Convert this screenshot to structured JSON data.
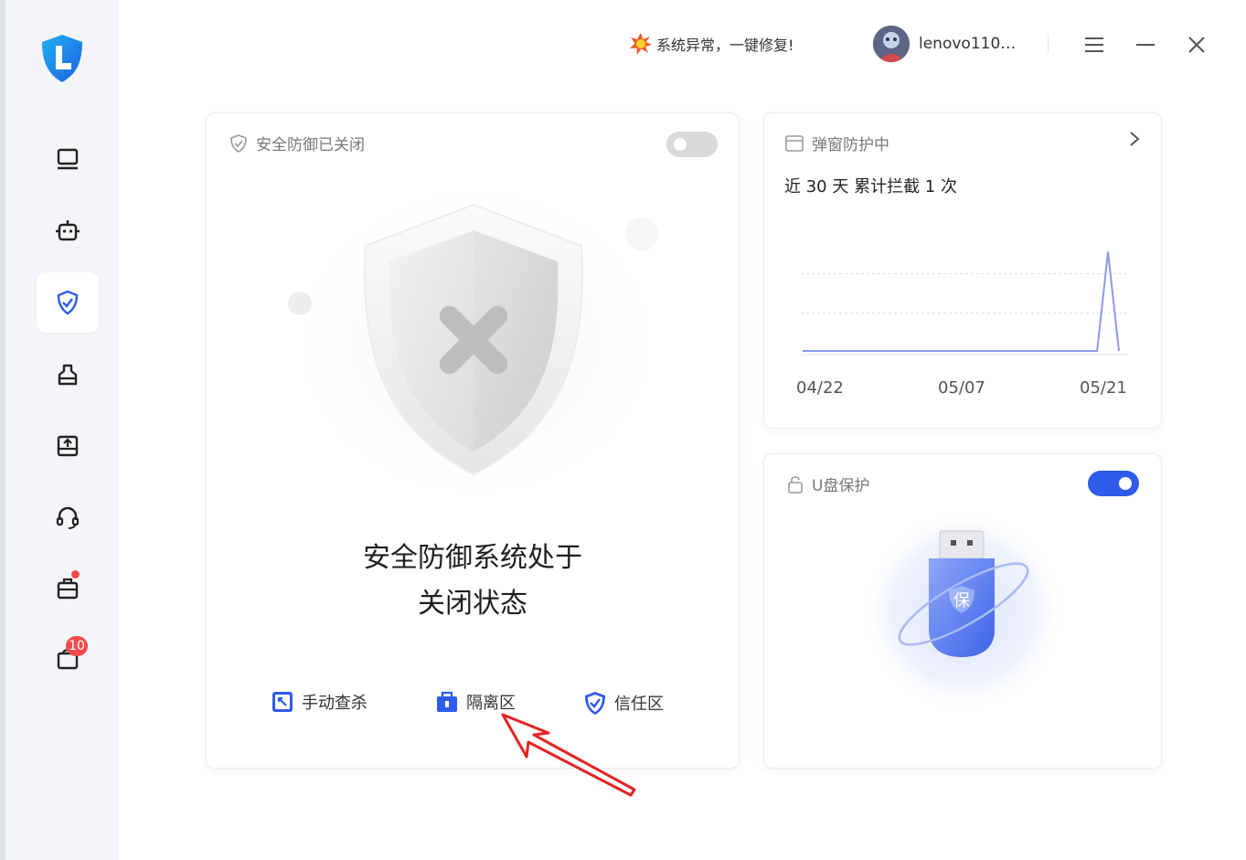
{
  "sidebar": {
    "items": [
      {
        "name": "computer-icon"
      },
      {
        "name": "robot-icon"
      },
      {
        "name": "shield-check-icon",
        "active": true
      },
      {
        "name": "broom-icon"
      },
      {
        "name": "box-upload-icon"
      },
      {
        "name": "headset-icon"
      },
      {
        "name": "toolbox-icon",
        "dot": true
      },
      {
        "name": "shopping-bag-icon",
        "badge": "10"
      }
    ]
  },
  "topbar": {
    "alert_text": "系统异常，一键修复!",
    "username": "lenovo110…"
  },
  "defense": {
    "header": "安全防御已关闭",
    "enabled": false,
    "status_line1": "安全防御系统处于",
    "status_line2": "关闭状态",
    "actions": [
      {
        "label": "手动查杀",
        "icon": "manual-scan-icon"
      },
      {
        "label": "隔离区",
        "icon": "quarantine-box-icon"
      },
      {
        "label": "信任区",
        "icon": "trust-shield-icon"
      }
    ]
  },
  "popup": {
    "header": "弹窗防护中",
    "subtitle": "近 30 天 累计拦截 1 次"
  },
  "usb": {
    "header": "U盘保护",
    "enabled": true,
    "badge_text": "保"
  },
  "colors": {
    "accent": "#2f5bea",
    "toggle_off": "#d9d9d9",
    "badge": "#f04b4b",
    "chart_line": "#8b9ae8"
  },
  "chart_data": {
    "type": "line",
    "x": [
      "04/22",
      "05/07",
      "05/21"
    ],
    "x_ticks": [
      "04/22",
      "05/07",
      "05/21"
    ],
    "series": [
      {
        "values_note": "",
        "values": [
          0,
          0,
          0,
          0,
          0,
          0,
          0,
          0,
          0,
          0,
          0,
          0,
          0,
          0,
          0,
          0,
          0,
          0,
          0,
          0,
          0,
          0,
          0,
          0,
          0,
          0,
          0,
          0,
          1,
          0
        ]
      }
    ],
    "ylim": [
      0,
      1.2
    ],
    "grid": true
  }
}
